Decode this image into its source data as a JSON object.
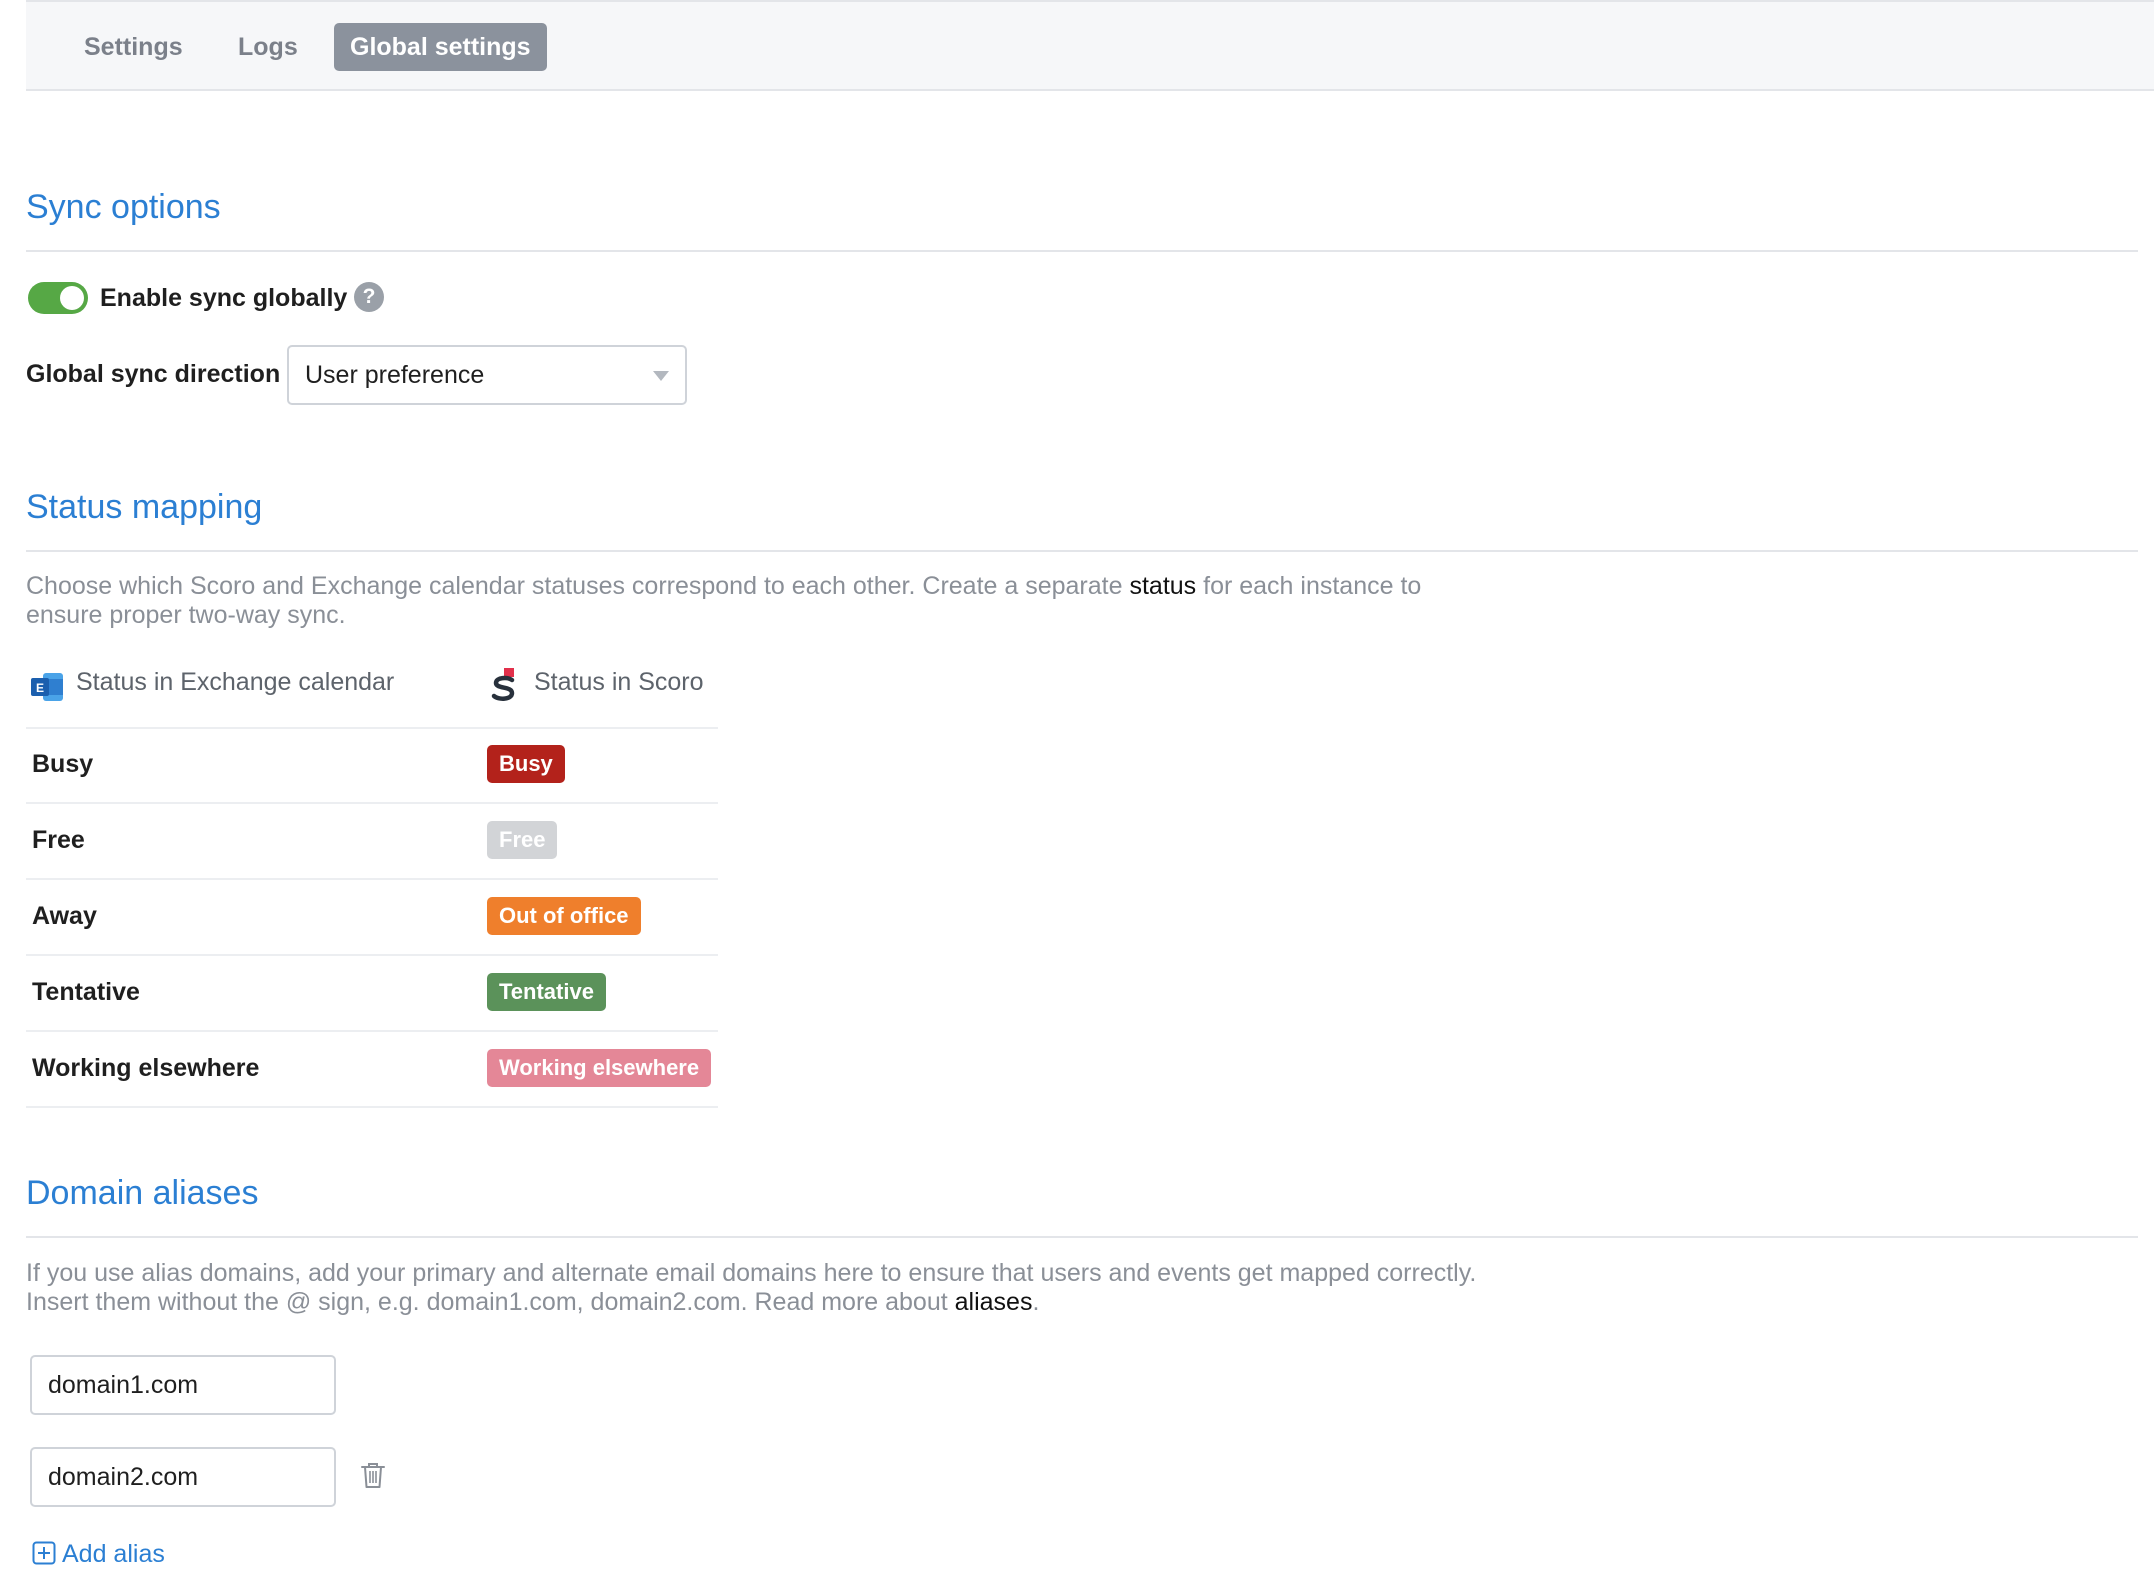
{
  "tabs": [
    {
      "label": "Settings",
      "active": false
    },
    {
      "label": "Logs",
      "active": false
    },
    {
      "label": "Global settings",
      "active": true
    }
  ],
  "sync_options": {
    "title": "Sync options",
    "enable_sync_label": "Enable sync globally",
    "enable_sync_on": true,
    "help_icon": "question-circle-icon",
    "direction_label": "Global sync direction",
    "direction_value": "User preference"
  },
  "status_mapping": {
    "title": "Status mapping",
    "description_before": "Choose which Scoro and Exchange calendar statuses correspond to each other. Create a separate ",
    "description_link": "status",
    "description_after": " for each instance to ensure proper two-way sync.",
    "col_exchange": "Status in Exchange calendar",
    "col_scoro": "Status in Scoro",
    "rows": [
      {
        "exchange": "Busy",
        "scoro": "Busy",
        "color": "#b3221b"
      },
      {
        "exchange": "Free",
        "scoro": "Free",
        "color": "#d2d4d7"
      },
      {
        "exchange": "Away",
        "scoro": "Out of office",
        "color": "#ef7f2c"
      },
      {
        "exchange": "Tentative",
        "scoro": "Tentative",
        "color": "#5b925a"
      },
      {
        "exchange": "Working elsewhere",
        "scoro": "Working elsewhere",
        "color": "#e48797"
      }
    ]
  },
  "domain_aliases": {
    "title": "Domain aliases",
    "description_before": "If you use alias domains, add your primary and alternate email domains here to ensure that users and events get mapped correctly. Insert them without the @ sign, e.g. domain1.com, domain2.com. Read more about ",
    "description_link": "aliases",
    "description_after": ".",
    "aliases": [
      "domain1.com",
      "domain2.com"
    ],
    "add_label": "Add alias"
  },
  "colors": {
    "accent": "#2b7fd3",
    "toggle_on": "#56a845",
    "active_tab": "#8b929d"
  }
}
